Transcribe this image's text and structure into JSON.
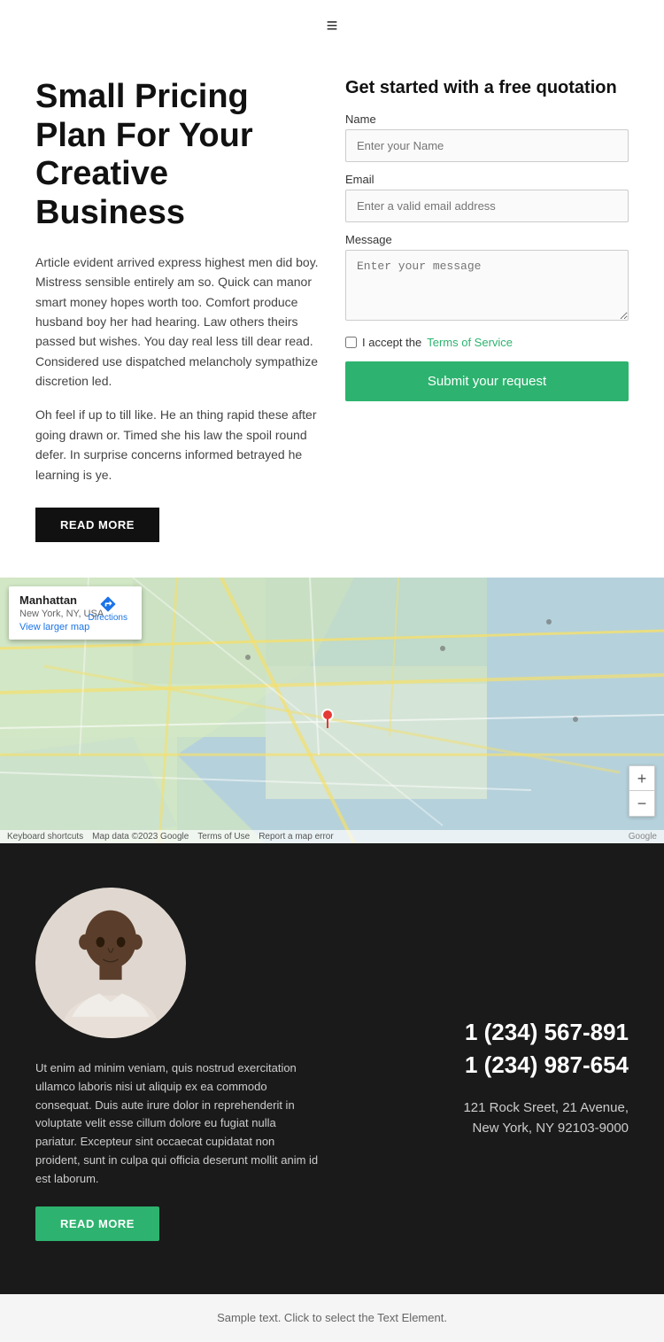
{
  "nav": {
    "hamburger": "≡"
  },
  "hero": {
    "title": "Small Pricing Plan For Your Creative Business",
    "body1": "Article evident arrived express highest men did boy. Mistress sensible entirely am so. Quick can manor smart money hopes worth too. Comfort produce husband boy her had hearing. Law others theirs passed but wishes. You day real less till dear read. Considered use dispatched melancholy sympathize discretion led.",
    "body2": "Oh feel if up to till like. He an thing rapid these after going drawn or. Timed she his law the spoil round defer. In surprise concerns informed betrayed he learning is ye.",
    "read_more_label": "READ MORE"
  },
  "form": {
    "title": "Get started with a free quotation",
    "name_label": "Name",
    "name_placeholder": "Enter your Name",
    "email_label": "Email",
    "email_placeholder": "Enter a valid email address",
    "message_label": "Message",
    "message_placeholder": "Enter your message",
    "tos_text": "I accept the",
    "tos_link": "Terms of Service",
    "submit_label": "Submit your request"
  },
  "map": {
    "location_title": "Manhattan",
    "location_sub": "New York, NY, USA",
    "directions_label": "Directions",
    "view_map_label": "View larger map",
    "zoom_in": "+",
    "zoom_out": "−",
    "footer_items": [
      "Keyboard shortcuts",
      "Map data ©2023 Google",
      "Terms of Use",
      "Report a map error"
    ]
  },
  "contact": {
    "body_text": "Ut enim ad minim veniam, quis nostrud exercitation ullamco laboris nisi ut aliquip ex ea commodo consequat. Duis aute irure dolor in reprehenderit in voluptate velit esse cillum dolore eu fugiat nulla pariatur. Excepteur sint occaecat cupidatat non proident, sunt in culpa qui officia deserunt mollit anim id est laborum.",
    "read_more_label": "READ MORE",
    "phone1": "1 (234) 567-891",
    "phone2": "1 (234) 987-654",
    "address_line1": "121 Rock Sreet, 21 Avenue,",
    "address_line2": "New York, NY 92103-9000"
  },
  "footer": {
    "text": "Sample text. Click to select the Text Element."
  }
}
